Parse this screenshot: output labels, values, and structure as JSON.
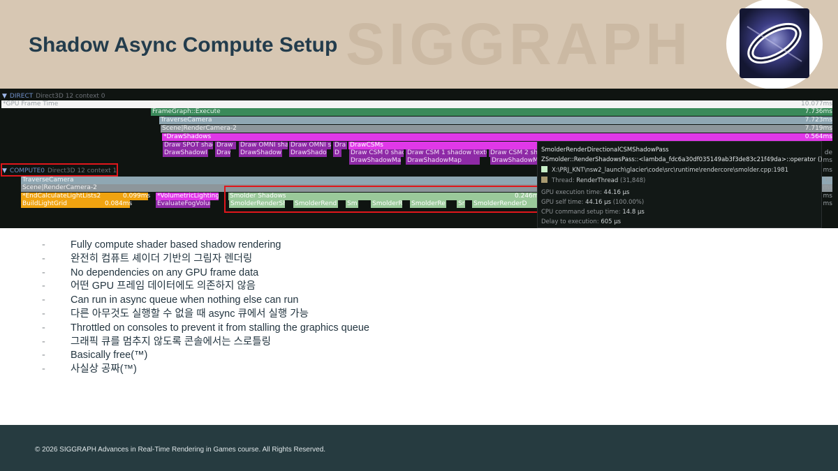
{
  "slide": {
    "title": "Shadow Async Compute Setup",
    "watermark": "SIGGRAPH",
    "bullets": [
      "Fully compute shader based shadow rendering",
      "완전히 컴퓨트 셰이더 기반의 그림자 렌더링",
      "No dependencies on any GPU frame data",
      "어떤 GPU 프레임 데이터에도 의존하지 않음",
      "Can run in async queue when nothing else can run",
      "다른 아무것도 실행할 수 없을 때 async 큐에서 실행 가능",
      "Throttled on consoles to prevent it from stalling the graphics queue",
      "그래픽 큐를 멈추지 않도록 콘솔에서는 스로틀링",
      "Basically free(™)",
      "사실상 공짜(™)"
    ],
    "bullet_marker": "-",
    "copyright": "© 2026 SIGGRAPH Advances in Real-Time Rendering in Games course. All Rights Reserved."
  },
  "profiler": {
    "direct_header": {
      "arrow": "▼",
      "name": "DIRECT",
      "context": "Direct3D 12 context 0"
    },
    "compute_header": {
      "arrow": "▼",
      "name": "COMPUTE0",
      "context": "Direct3D 12 context 1"
    },
    "gpu_frame_time": {
      "label": "*GPU Frame Time",
      "ms": "10.077ms"
    },
    "framegraph": {
      "label": "FrameGraph::Execute",
      "ms": "7.736ms"
    },
    "traverse_camera": {
      "label": "TraverseCamera",
      "ms": "7.723ms"
    },
    "scene_render_camera": {
      "label": "Scene|RenderCamera-2",
      "ms": "7.719ms"
    },
    "draw_shadows": {
      "label": "*DrawShadows",
      "ms": "0.564ms"
    },
    "draw_row": [
      "Draw SPOT shad",
      "Draw",
      "Draw OMNI sha",
      "Draw OMNI s",
      "Dra",
      "DrawCSMs"
    ],
    "shadow_row": [
      "DrawShadowI",
      "Draw",
      "DrawShadow",
      "DrawShado",
      "D",
      "Draw CSM 0 shad",
      "Draw CSM 1 shadow textu",
      "Draw CSM 2 sha"
    ],
    "shadowmap_row": [
      "DrawShadowMa",
      "DrawShadowMap",
      "DrawShadowM"
    ],
    "compute_traverse": "TraverseCamera",
    "compute_scene": "Scene|RenderCamera-2",
    "end_calc": {
      "label": "*EndCalculateLightLists2",
      "ms": "0.099ms"
    },
    "build_grid": {
      "label": "BuildLightGrid",
      "ms": "0.084ms"
    },
    "vol_lighting": "*VolumetricLighting",
    "eval_fog": "EvaluateFogVolur",
    "smolder_shadows": {
      "label": "Smolder Shadows",
      "ms": "0.246m"
    },
    "smolder_row": [
      "SmolderRenderSh",
      "SmolderRend",
      "Sm",
      "SmolderR",
      "SmolderRe",
      "Sr",
      "SmolderRenderD"
    ],
    "right_ms_fragments": [
      "de",
      "ms",
      "ms",
      "Tir",
      "ms",
      "ms",
      "ms"
    ]
  },
  "tooltip": {
    "title": "SmolderRenderDirectionalCSMShadowPass",
    "function": "ZSmolder::RenderShadowsPass::<lambda_fdc6a30df035149ab3f3de83c21f49da>::operator ()",
    "file": "X:\\PRJ_KNT\\nsw2_launch\\glacier\\code\\src\\runtime\\rendercore\\smolder.cpp:1981",
    "thread_label": "Thread:",
    "thread": "RenderThread",
    "thread_id": "(31,848)",
    "stats": [
      {
        "label": "GPU execution time:",
        "value": "44.16 μs"
      },
      {
        "label": "GPU self time:",
        "value": "44.16 μs",
        "extra": "(100.00%)"
      },
      {
        "label": "CPU command setup time:",
        "value": "14.8 μs"
      },
      {
        "label": "Delay to execution:",
        "value": "605 μs"
      }
    ],
    "colors": {
      "file_swatch": "#c8f0c8",
      "thread_swatch": "#a89a70"
    }
  }
}
